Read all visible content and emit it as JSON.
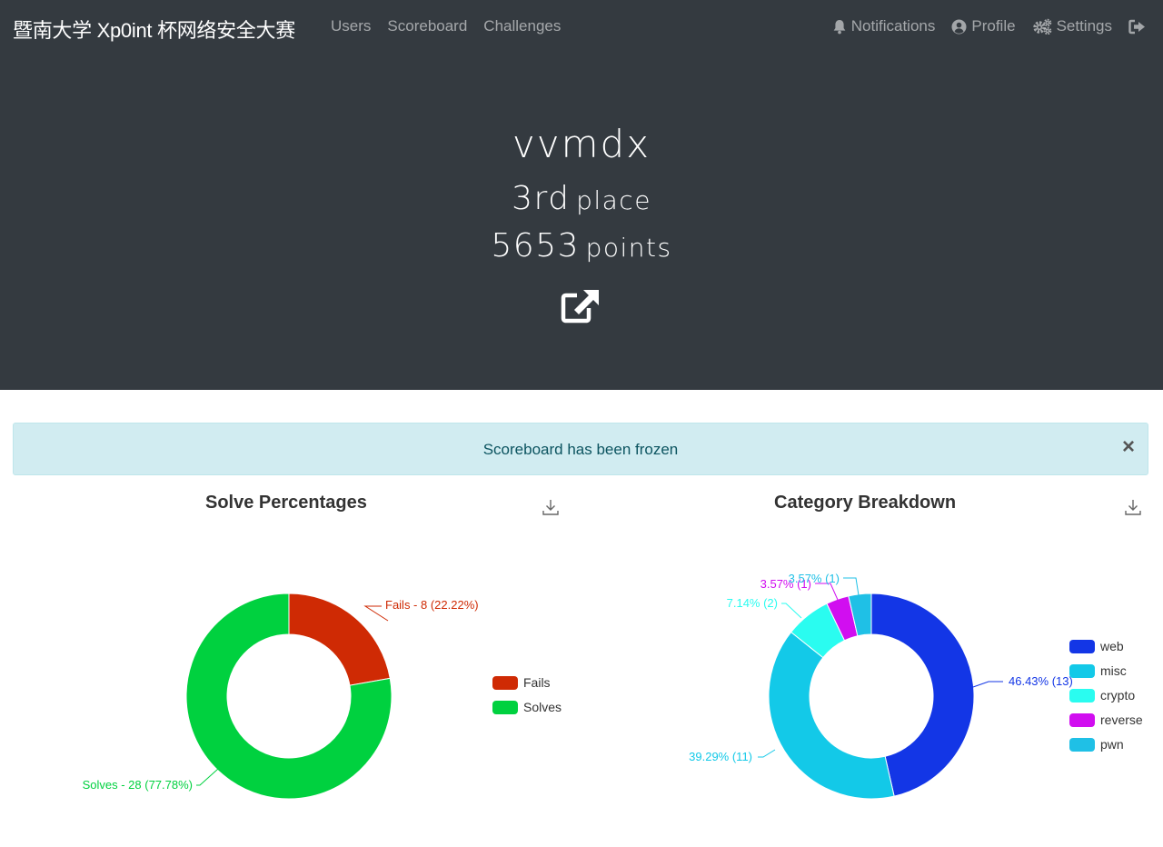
{
  "navbar": {
    "brand": "暨南大学 Xp0int 杯网络安全大赛",
    "links": [
      "Users",
      "Scoreboard",
      "Challenges"
    ],
    "right": [
      {
        "icon": "bell-icon",
        "label": "Notifications"
      },
      {
        "icon": "user-circle-icon",
        "label": "Profile"
      },
      {
        "icon": "cogs-icon",
        "label": "Settings"
      },
      {
        "icon": "sign-out-icon",
        "label": ""
      }
    ]
  },
  "profile": {
    "name": "vvmdx",
    "place_value": "3rd",
    "place_label": "place",
    "points_value": "5653",
    "points_label": "points",
    "website_icon": "external-link-icon"
  },
  "alert": {
    "text": "Scoreboard has been frozen",
    "close": "×"
  },
  "chart_data": [
    {
      "type": "pie",
      "title": "Solve Percentages",
      "donut": true,
      "legend_position": "right",
      "slices": [
        {
          "name": "Fails",
          "value": 8,
          "percent": 22.22,
          "color": "#cf2a04",
          "label": "Fails - 8 (22.22%)"
        },
        {
          "name": "Solves",
          "value": 28,
          "percent": 77.78,
          "color": "#00d13f",
          "label": "Solves - 28 (77.78%)"
        }
      ]
    },
    {
      "type": "pie",
      "title": "Category Breakdown",
      "donut": true,
      "legend_position": "right",
      "slices": [
        {
          "name": "web",
          "value": 13,
          "percent": 46.43,
          "color": "#1336e6",
          "label": "46.43% (13)"
        },
        {
          "name": "misc",
          "value": 11,
          "percent": 39.29,
          "color": "#13c9e8",
          "label": "39.29% (11)"
        },
        {
          "name": "crypto",
          "value": 2,
          "percent": 7.14,
          "color": "#2afcf0",
          "label": "7.14% (2)"
        },
        {
          "name": "reverse",
          "value": 1,
          "percent": 3.57,
          "color": "#d10ef0",
          "label": "3.57% (1)"
        },
        {
          "name": "pwn",
          "value": 1,
          "percent": 3.57,
          "color": "#1fc0e6",
          "label": "3.57% (1)"
        }
      ]
    }
  ]
}
